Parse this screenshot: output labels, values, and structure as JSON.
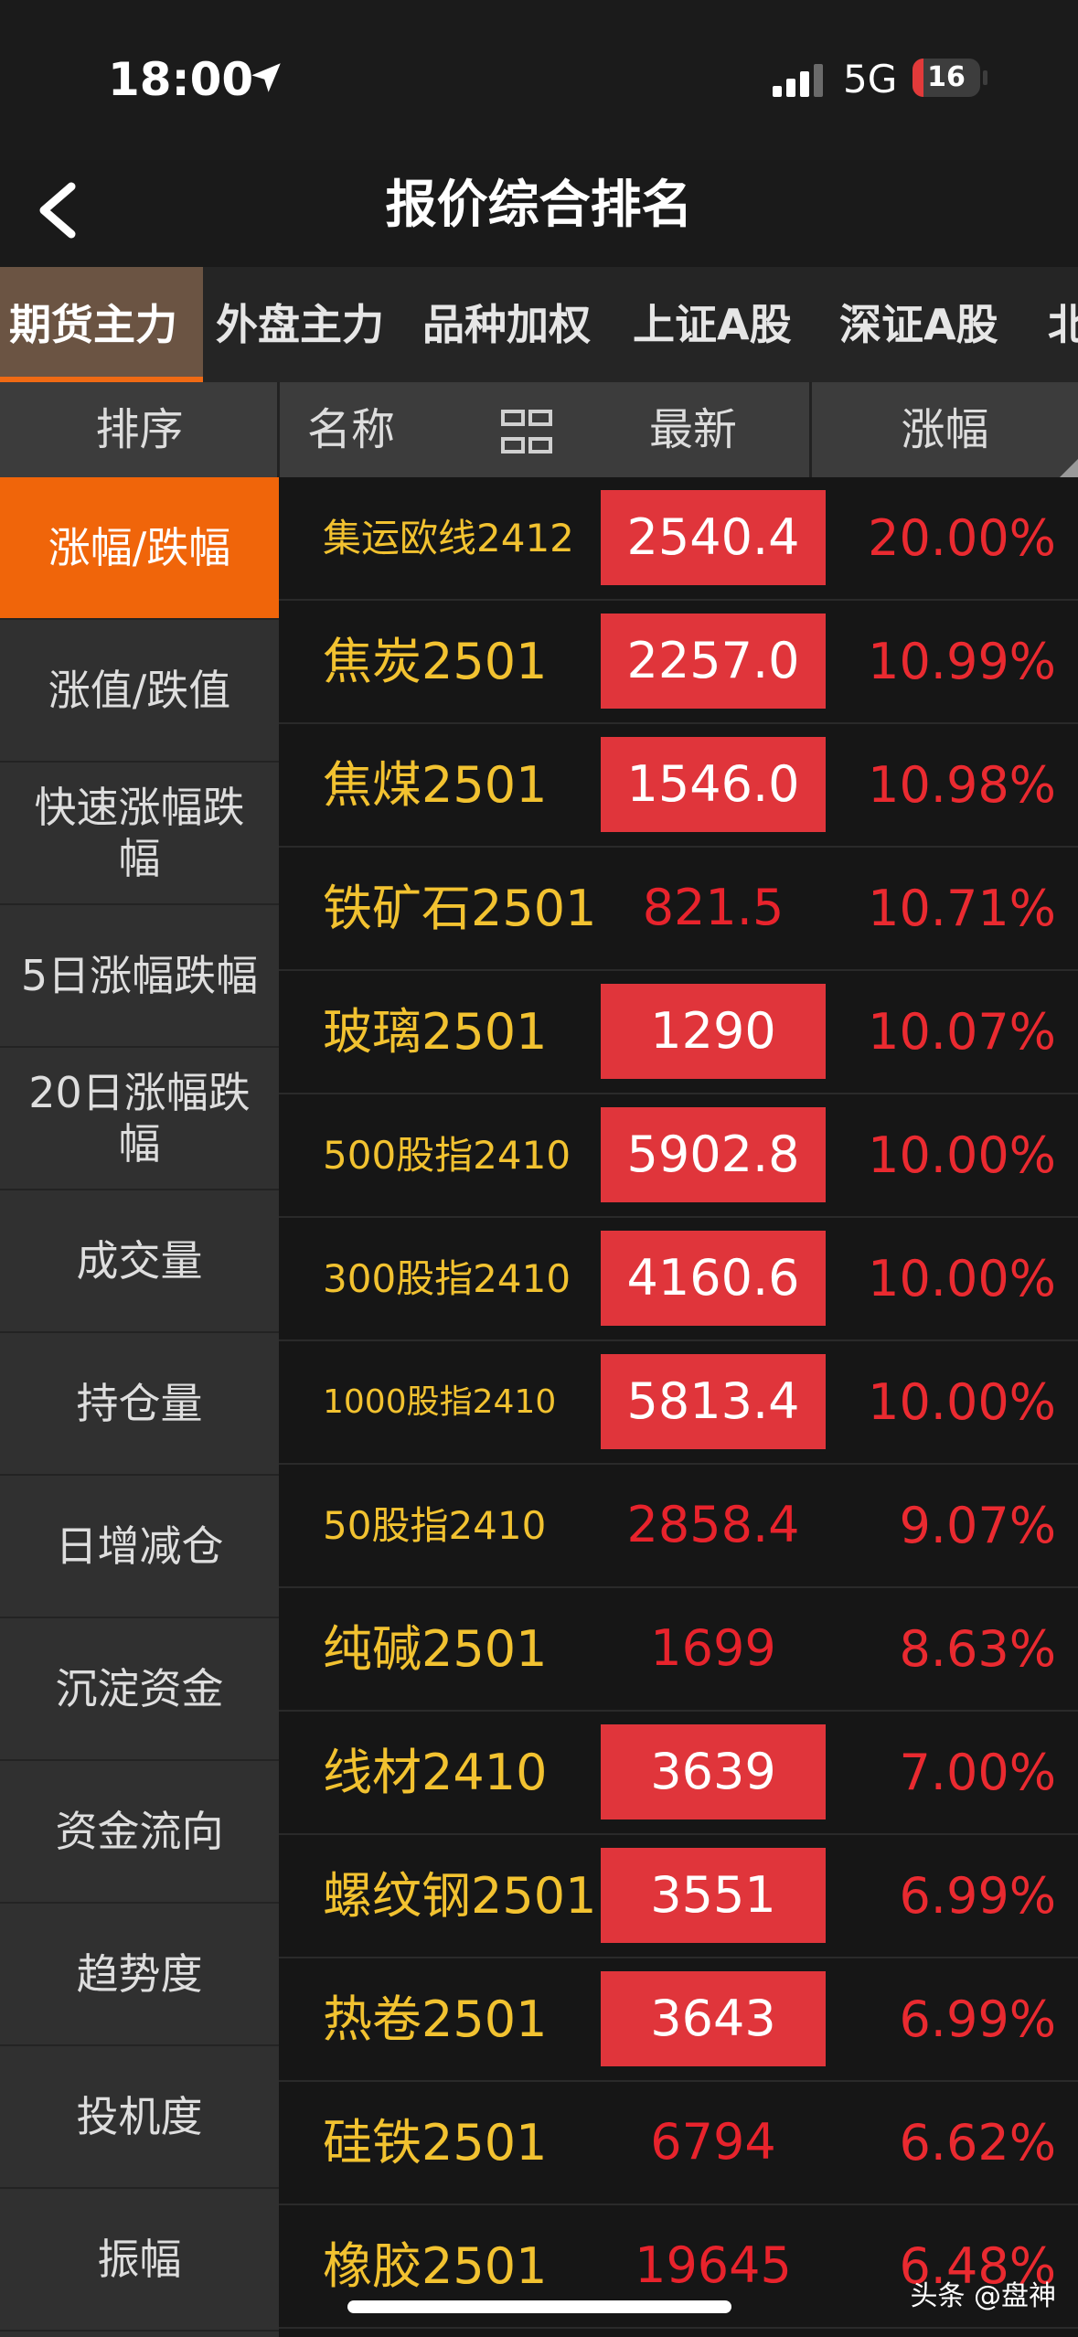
{
  "status_bar": {
    "time": "18:00",
    "network": "5G",
    "battery": "16",
    "battery_level": 0.16
  },
  "header": {
    "title": "报价综合排名"
  },
  "tabs": [
    {
      "label": "期货主力",
      "active": true
    },
    {
      "label": "外盘主力",
      "active": false
    },
    {
      "label": "品种加权",
      "active": false
    },
    {
      "label": "上证A股",
      "active": false
    },
    {
      "label": "深证A股",
      "active": false
    },
    {
      "label": "北",
      "active": false
    }
  ],
  "columns": {
    "sort": "排序",
    "name": "名称",
    "latest": "最新",
    "change": "涨幅"
  },
  "menu": [
    {
      "label": "涨幅/跌幅",
      "active": true
    },
    {
      "label": "涨值/跌值",
      "active": false
    },
    {
      "label": "快速涨幅跌幅",
      "active": false
    },
    {
      "label": "5日涨幅跌幅",
      "active": false
    },
    {
      "label": "20日涨幅跌幅",
      "active": false
    },
    {
      "label": "成交量",
      "active": false
    },
    {
      "label": "持仓量",
      "active": false
    },
    {
      "label": "日增减仓",
      "active": false
    },
    {
      "label": "沉淀资金",
      "active": false
    },
    {
      "label": "资金流向",
      "active": false
    },
    {
      "label": "趋势度",
      "active": false
    },
    {
      "label": "投机度",
      "active": false
    },
    {
      "label": "振幅",
      "active": false
    }
  ],
  "rows": [
    {
      "name": "集运欧线2412",
      "price": "2540.4",
      "change": "20.00%",
      "highlight": true
    },
    {
      "name": "焦炭2501",
      "price": "2257.0",
      "change": "10.99%",
      "highlight": true
    },
    {
      "name": "焦煤2501",
      "price": "1546.0",
      "change": "10.98%",
      "highlight": true
    },
    {
      "name": "铁矿石2501",
      "price": "821.5",
      "change": "10.71%",
      "highlight": false
    },
    {
      "name": "玻璃2501",
      "price": "1290",
      "change": "10.07%",
      "highlight": true
    },
    {
      "name": "500股指2410",
      "price": "5902.8",
      "change": "10.00%",
      "highlight": true
    },
    {
      "name": "300股指2410",
      "price": "4160.6",
      "change": "10.00%",
      "highlight": true
    },
    {
      "name": "1000股指2410",
      "price": "5813.4",
      "change": "10.00%",
      "highlight": true
    },
    {
      "name": "50股指2410",
      "price": "2858.4",
      "change": "9.07%",
      "highlight": false
    },
    {
      "name": "纯碱2501",
      "price": "1699",
      "change": "8.63%",
      "highlight": false
    },
    {
      "name": "线材2410",
      "price": "3639",
      "change": "7.00%",
      "highlight": true
    },
    {
      "name": "螺纹钢2501",
      "price": "3551",
      "change": "6.99%",
      "highlight": true
    },
    {
      "name": "热卷2501",
      "price": "3643",
      "change": "6.99%",
      "highlight": true
    },
    {
      "name": "硅铁2501",
      "price": "6794",
      "change": "6.62%",
      "highlight": false
    },
    {
      "name": "橡胶2501",
      "price": "19645",
      "change": "6.48%",
      "highlight": false
    }
  ],
  "watermark": "头条 @盘神",
  "colors": {
    "accent": "#f0650a",
    "up_red": "#e0353b",
    "name_yellow": "#f2c230"
  },
  "icons": [
    "location-arrow-icon",
    "signal-bars-icon",
    "back-chevron-icon",
    "grid-toggle-icon"
  ]
}
